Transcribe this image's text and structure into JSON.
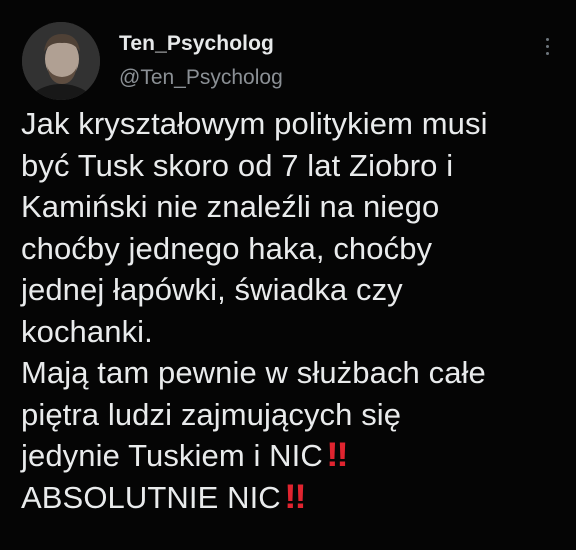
{
  "author": {
    "display_name": "Ten_Psycholog",
    "handle": "@Ten_Psycholog",
    "avatar_icon": "profile-avatar"
  },
  "tweet": {
    "lines": [
      "Jak kryształowym politykiem musi",
      "być Tusk skoro od 7 lat Ziobro i",
      "Kamiński nie znaleźli na niego",
      "choćby jednego haka, choćby",
      "jednej łapówki, świadka czy",
      "kochanki.",
      "Mają tam pewnie w służbach całe",
      "piętra ludzi zajmujących się",
      "jedynie Tuskiem i NIC",
      "ABSOLUTNIE NIC"
    ],
    "emphasis": "‼"
  },
  "icons": {
    "more": "more-options-icon",
    "emphasis": "double-exclamation-icon"
  },
  "colors": {
    "background": "#050505",
    "text": "#e9ebec",
    "secondary_text": "#8b9095",
    "emphasis": "#e0242f"
  }
}
